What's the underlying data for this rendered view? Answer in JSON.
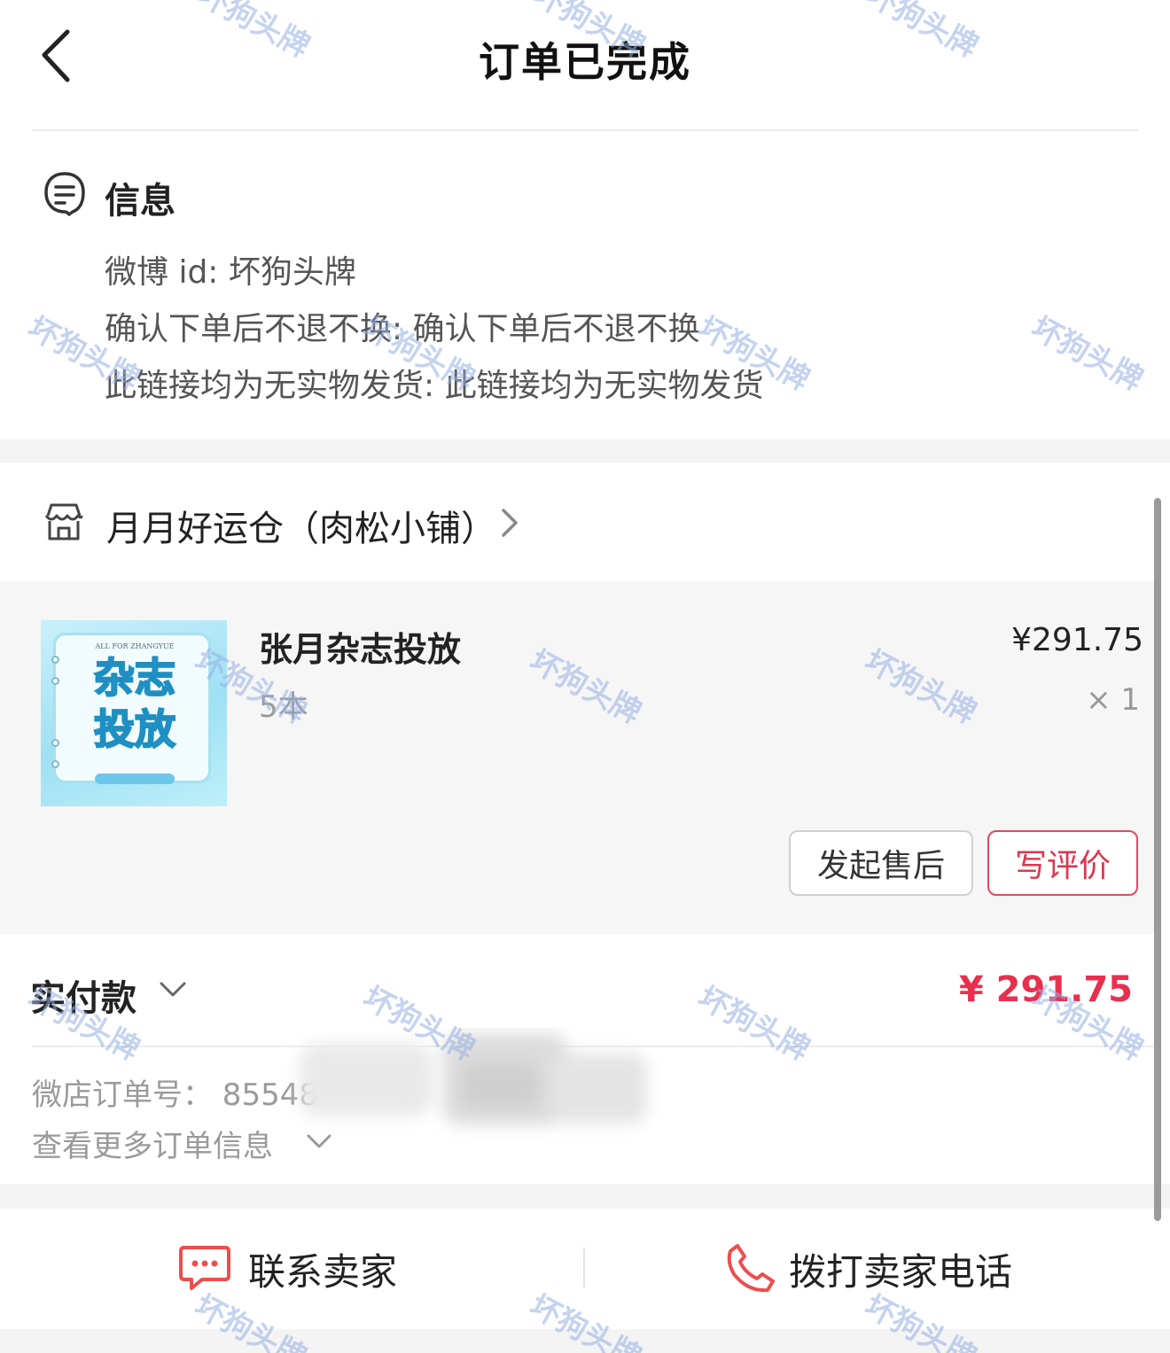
{
  "header": {
    "title": "订单已完成"
  },
  "info": {
    "title": "信息",
    "lines": [
      "微博 id: 坏狗头牌",
      "确认下单后不退不换: 确认下单后不退不换",
      "此链接均为无实物发货: 此链接均为无实物发货"
    ]
  },
  "shop": {
    "name": "月月好运仓（肉松小铺）"
  },
  "product": {
    "title": "张月杂志投放",
    "spec": "5本",
    "price": "¥291.75",
    "qty": "× 1",
    "thumb_top_text": "ALL FOR ZHANGYUE",
    "thumb_line1": "杂志",
    "thumb_line2": "投放",
    "after_sale_label": "发起售后",
    "review_label": "写评价"
  },
  "payment": {
    "paid_label": "实付款",
    "paid_amount": "¥ 291.75",
    "order_no": "微店订单号：  85548",
    "more_label": "查看更多订单信息"
  },
  "bottom_bar": {
    "contact_label": "联系卖家",
    "call_label": "拨打卖家电话"
  },
  "watermark": "坏狗头牌",
  "colors": {
    "accent_red": "#e8304e",
    "band_gray": "#f4f4f4",
    "thumb_blue": "#9fe0f3"
  },
  "icons": {
    "back": "chevron-left-icon",
    "info": "message-lines-icon",
    "shop": "store-icon",
    "chat": "chat-bubble-icon",
    "phone": "phone-icon"
  }
}
